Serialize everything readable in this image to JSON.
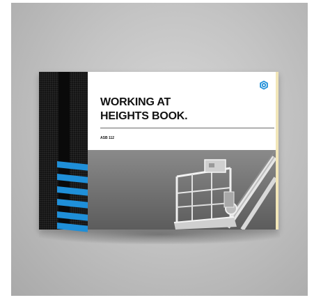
{
  "book": {
    "title_line1": "WORKING AT",
    "title_line2": "HEIGHTS BOOK.",
    "code": "ASB 112"
  },
  "icons": {
    "logo": "hexagon-logo-icon"
  },
  "colors": {
    "accent": "#1f8fd8",
    "spine": "#141414",
    "page_edge": "#f2e6b8"
  }
}
